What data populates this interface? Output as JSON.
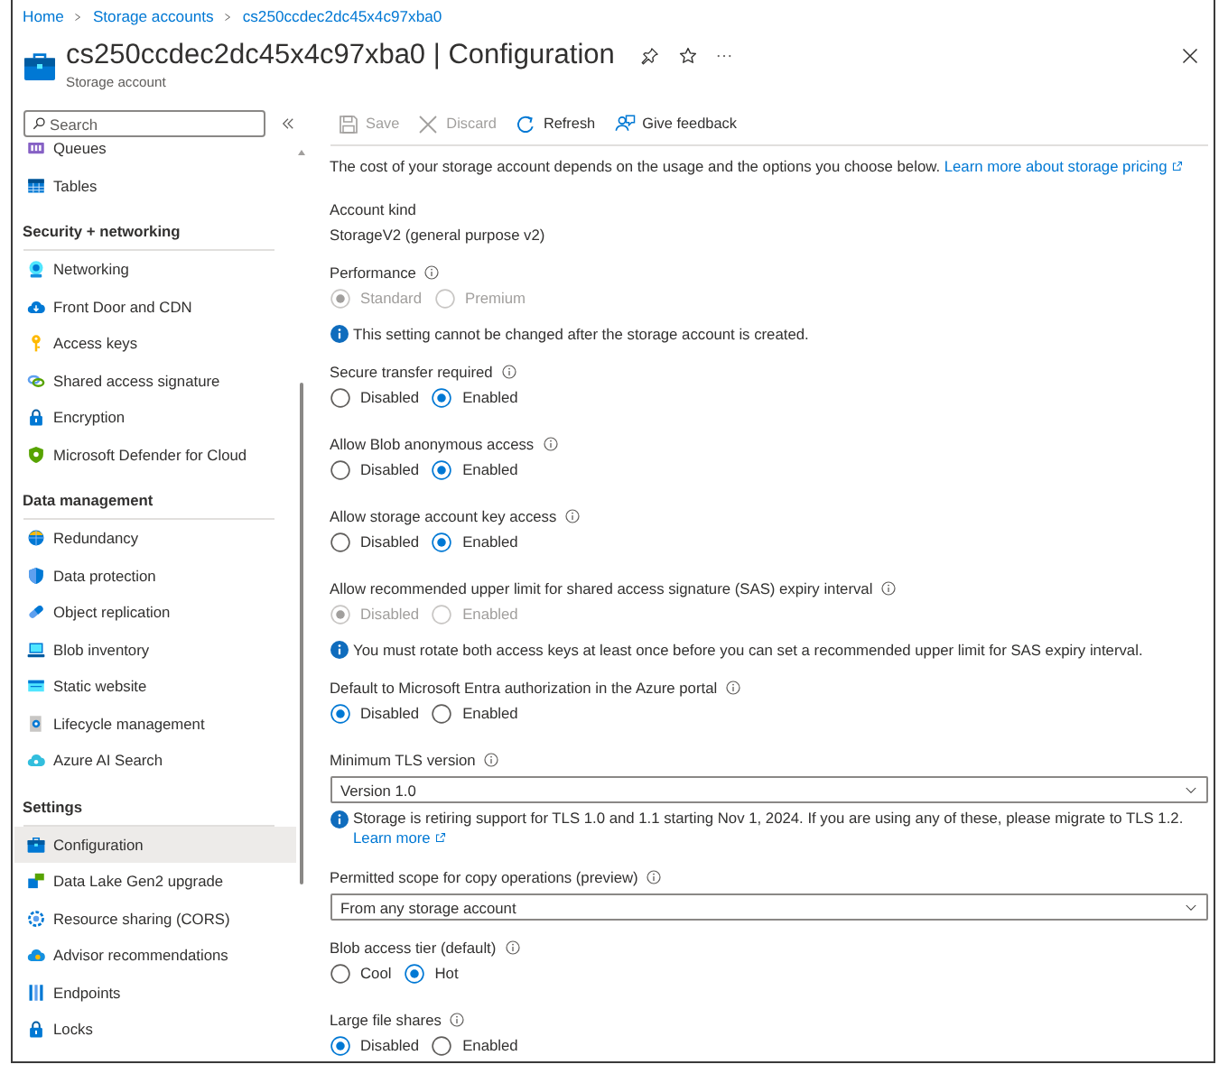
{
  "breadcrumb": [
    {
      "label": "Home"
    },
    {
      "label": "Storage accounts"
    },
    {
      "label": "cs250ccdec2dc45x4c97xba0"
    }
  ],
  "header": {
    "title": "cs250ccdec2dc45x4c97xba0 | Configuration",
    "subtitle": "Storage account"
  },
  "sidebar": {
    "search": {
      "placeholder": "Search"
    },
    "sections": [
      {
        "items": [
          {
            "label": "Queues",
            "selected": false
          },
          {
            "label": "Tables",
            "selected": false
          }
        ]
      },
      {
        "heading": "Security + networking",
        "items": [
          {
            "label": "Networking",
            "selected": false
          },
          {
            "label": "Front Door and CDN",
            "selected": false
          },
          {
            "label": "Access keys",
            "selected": false
          },
          {
            "label": "Shared access signature",
            "selected": false
          },
          {
            "label": "Encryption",
            "selected": false
          },
          {
            "label": "Microsoft Defender for Cloud",
            "selected": false
          }
        ]
      },
      {
        "heading": "Data management",
        "items": [
          {
            "label": "Redundancy",
            "selected": false
          },
          {
            "label": "Data protection",
            "selected": false
          },
          {
            "label": "Object replication",
            "selected": false
          },
          {
            "label": "Blob inventory",
            "selected": false
          },
          {
            "label": "Static website",
            "selected": false
          },
          {
            "label": "Lifecycle management",
            "selected": false
          },
          {
            "label": "Azure AI Search",
            "selected": false
          }
        ]
      },
      {
        "heading": "Settings",
        "items": [
          {
            "label": "Configuration",
            "selected": true
          },
          {
            "label": "Data Lake Gen2 upgrade",
            "selected": false
          },
          {
            "label": "Resource sharing (CORS)",
            "selected": false
          },
          {
            "label": "Advisor recommendations",
            "selected": false
          },
          {
            "label": "Endpoints",
            "selected": false
          },
          {
            "label": "Locks",
            "selected": false
          }
        ]
      }
    ]
  },
  "toolbar": [
    {
      "label": "Save",
      "disabled": true
    },
    {
      "label": "Discard",
      "disabled": true
    },
    {
      "label": "Refresh",
      "disabled": false
    },
    {
      "label": "Give feedback",
      "disabled": false
    }
  ],
  "content": {
    "intro": {
      "text": "The cost of your storage account depends on the usage and the options you choose below.",
      "link": "Learn more about storage pricing"
    },
    "fields": [
      {
        "kind": "text",
        "label": "Account kind",
        "value": "StorageV2 (general purpose v2)"
      },
      {
        "kind": "radio",
        "label": "Performance",
        "disabled": true,
        "options": [
          {
            "label": "Standard",
            "selected": true
          },
          {
            "label": "Premium",
            "selected": false
          }
        ],
        "note": "This setting cannot be changed after the storage account is created."
      },
      {
        "kind": "radio",
        "label": "Secure transfer required",
        "disabled": false,
        "options": [
          {
            "label": "Disabled",
            "selected": false
          },
          {
            "label": "Enabled",
            "selected": true
          }
        ]
      },
      {
        "kind": "radio",
        "label": "Allow Blob anonymous access",
        "disabled": false,
        "options": [
          {
            "label": "Disabled",
            "selected": false
          },
          {
            "label": "Enabled",
            "selected": true
          }
        ]
      },
      {
        "kind": "radio",
        "label": "Allow storage account key access",
        "disabled": false,
        "options": [
          {
            "label": "Disabled",
            "selected": false
          },
          {
            "label": "Enabled",
            "selected": true
          }
        ]
      },
      {
        "kind": "radio",
        "label": "Allow recommended upper limit for shared access signature (SAS) expiry interval",
        "disabled": true,
        "options": [
          {
            "label": "Disabled",
            "selected": true
          },
          {
            "label": "Enabled",
            "selected": false
          }
        ],
        "note": "You must rotate both access keys at least once before you can set a recommended upper limit for SAS expiry interval."
      },
      {
        "kind": "radio",
        "label": "Default to Microsoft Entra authorization in the Azure portal",
        "disabled": false,
        "options": [
          {
            "label": "Disabled",
            "selected": true
          },
          {
            "label": "Enabled",
            "selected": false
          }
        ]
      },
      {
        "kind": "dropdown",
        "label": "Minimum TLS version",
        "value": "Version 1.0",
        "note": "Storage is retiring support for TLS 1.0 and 1.1 starting Nov 1, 2024. If you are using any of these, please migrate to TLS 1.2.",
        "note_link": "Learn more"
      },
      {
        "kind": "dropdown",
        "label": "Permitted scope for copy operations (preview)",
        "value": "From any storage account"
      },
      {
        "kind": "radio",
        "label": "Blob access tier (default)",
        "disabled": false,
        "options": [
          {
            "label": "Cool",
            "selected": false
          },
          {
            "label": "Hot",
            "selected": true
          }
        ]
      },
      {
        "kind": "radio",
        "label": "Large file shares",
        "disabled": false,
        "options": [
          {
            "label": "Disabled",
            "selected": true
          },
          {
            "label": "Enabled",
            "selected": false
          }
        ]
      }
    ]
  }
}
